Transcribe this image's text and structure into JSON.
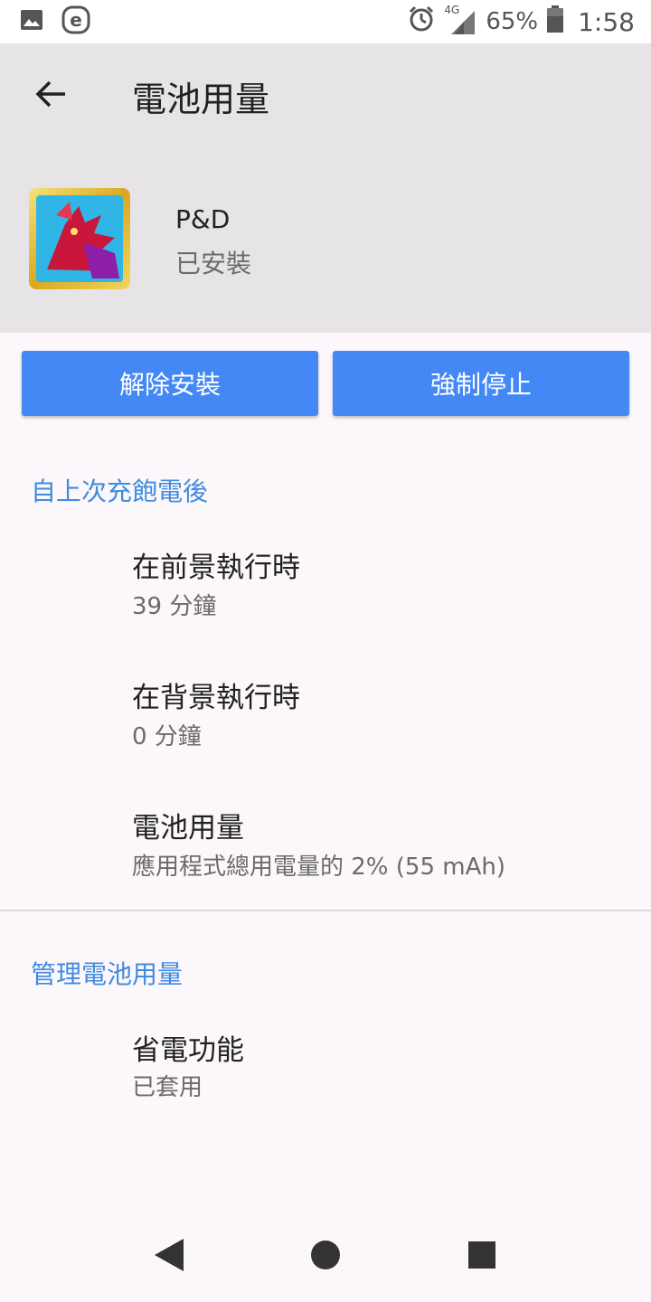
{
  "status_bar": {
    "network": "4G",
    "battery_percent": "65%",
    "time": "1:58",
    "icons": [
      "image-icon",
      "e-app-icon",
      "alarm-icon",
      "signal-icon",
      "battery-icon"
    ]
  },
  "app_bar": {
    "title": "電池用量",
    "back_icon": "back-arrow-icon"
  },
  "app_header": {
    "name": "P&D",
    "status": "已安裝"
  },
  "buttons": {
    "uninstall": "解除安裝",
    "force_stop": "強制停止"
  },
  "section_since_charge": {
    "header": "自上次充飽電後",
    "items": [
      {
        "title": "在前景執行時",
        "summary": "39 分鐘"
      },
      {
        "title": "在背景執行時",
        "summary": "0 分鐘"
      },
      {
        "title": "電池用量",
        "summary": "應用程式總用電量的 2% (55 mAh)"
      }
    ]
  },
  "section_manage": {
    "header": "管理電池用量",
    "items": [
      {
        "title": "省電功能",
        "summary": "已套用"
      }
    ]
  },
  "colors": {
    "accent": "#3F8BE0",
    "button": "#4488F6",
    "header_bg": "#E7E4E7",
    "page_bg": "#FBF7FB"
  },
  "nav": {
    "icons": [
      "nav-back-icon",
      "nav-home-icon",
      "nav-recents-icon"
    ]
  }
}
